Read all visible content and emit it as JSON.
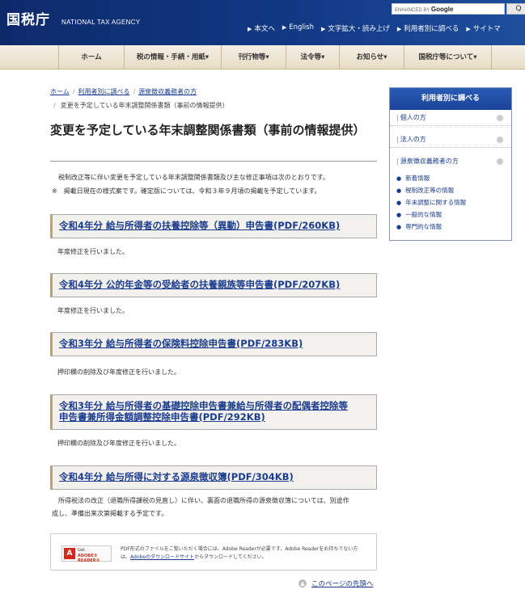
{
  "header": {
    "logo": "国税庁",
    "agency": "NATIONAL TAX AGENCY",
    "search_enhanced": "ENHANCED BY",
    "search_brand": "Google",
    "search_button": "Q",
    "links": [
      "本文へ",
      "English",
      "文字拡大・読み上げ",
      "利用者別に調べる",
      "サイトマ"
    ]
  },
  "nav": [
    "ホーム",
    "税の情報・手続・用紙▾",
    "刊行物等▾",
    "法令等▾",
    "お知らせ▾",
    "国税庁等について▾"
  ],
  "breadcrumb": {
    "home": "ホーム",
    "by_user": "利用者別に調べる",
    "withholding": "源泉徴収義務者の方",
    "current": "変更を予定している年末調整関係書類（事前の情報提供）"
  },
  "page": {
    "title": "変更を予定している年末調整関係書類（事前の情報提供）",
    "intro1": "税制改正等に伴い変更を予定している年末調整関係書類及び主な修正事項は次のとおりです。",
    "intro2": "※　掲載日現在の様式案です。確定版については、令和３年９月頃の掲載を予定しています。"
  },
  "documents": [
    {
      "title": "令和4年分 給与所得者の扶養控除等（異動）申告書(PDF/260KB)",
      "note": "年度修正を行いました。"
    },
    {
      "title": "令和4年分 公的年金等の受給者の扶養親族等申告書(PDF/207KB)",
      "note": "年度修正を行いました。"
    },
    {
      "title": "令和3年分 給与所得者の保険料控除申告書(PDF/283KB)",
      "note": "押印欄の削除及び年度修正を行いました。"
    },
    {
      "title_line1": "令和3年分 給与所得者の基礎控除申告書兼給与所得者の配偶者控除等",
      "title_line2": "申告書兼所得金額調整控除申告書(PDF/292KB)",
      "note": "押印欄の削除及び年度修正を行いました。"
    },
    {
      "title": "令和4年分 給与所得に対する源泉徴収簿(PDF/304KB)",
      "note_line1": "所得税法の改正（退職所得課税の見直し）に伴い、裏面の退職所得の源泉徴収簿については、別途作",
      "note_line2": "成し、準備出来次第掲載する予定です。"
    }
  ],
  "adobe": {
    "logo": "A",
    "get": "Get",
    "reader": "ADOBE® READER®",
    "text1": "PDF形式のファイルをご覧いただく場合には、Adobe Readerが必要です。Adobe Readerをお持ちでない方",
    "text2_pre": "は、",
    "text2_link": "Adobeのダウンロードサイト",
    "text2_post": "からダウンロードしてください。"
  },
  "totop": "このページの先頭へ",
  "sidebar": {
    "heading": "利用者別に調べる",
    "items": [
      "個人の方",
      "法人の方",
      "源泉徴収義務者の方"
    ],
    "subitems": [
      "新着情報",
      "税制改正等の情報",
      "年末調整に関する情報",
      "一般的な情報",
      "専門的な情報"
    ]
  },
  "colors": {
    "header_blue": "#123a86",
    "link_blue": "#1a3c8e",
    "nav_beige": "#e8dcc5"
  }
}
